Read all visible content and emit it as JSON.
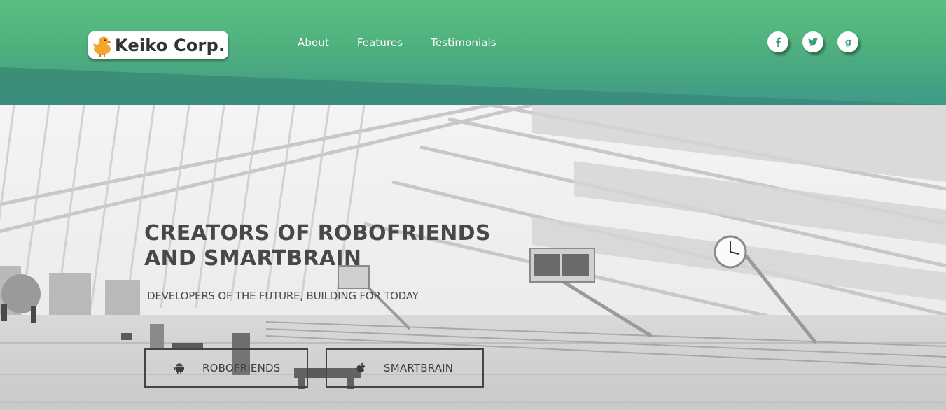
{
  "brand": {
    "name": "Keiko Corp."
  },
  "nav": {
    "items": [
      {
        "label": "About"
      },
      {
        "label": "Features"
      },
      {
        "label": "Testimonials"
      }
    ]
  },
  "social": [
    {
      "icon": "facebook-icon",
      "glyph": "f"
    },
    {
      "icon": "twitter-icon",
      "glyph": "🐦"
    },
    {
      "icon": "google-icon",
      "glyph": "g"
    }
  ],
  "hero": {
    "title_line1": "CREATORS OF ROBOFRIENDS",
    "title_line2": "AND SMARTBRAIN",
    "subtitle": "DEVELOPERS OF THE FUTURE, BUILDING FOR TODAY",
    "buttons": [
      {
        "label": "ROBOFRIENDS",
        "icon": "android-icon"
      },
      {
        "label": "SMARTBRAIN",
        "icon": "apple-icon"
      }
    ]
  },
  "colors": {
    "header_top": "#5bbf80",
    "header_bottom": "#3f9a86",
    "accent": "#3e9b7c",
    "hero_text": "#484848"
  }
}
